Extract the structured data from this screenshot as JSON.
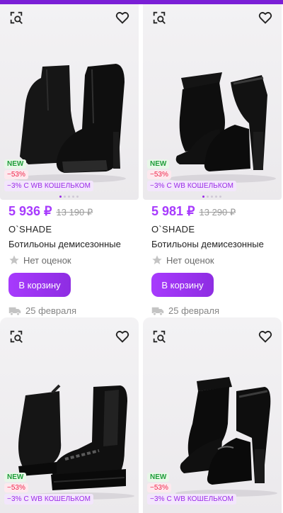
{
  "accent_color": "#a73afd",
  "products": [
    {
      "badge_new": "NEW",
      "badge_sale": "−53%",
      "badge_wallet": "−3% С WB КОШЕЛЬКОМ",
      "price": "5 936 ₽",
      "old_price": "13 190 ₽",
      "brand": "O`SHADE",
      "name": "Ботильоны демисезонные",
      "rating_text": "Нет оценок",
      "cart_label": "В корзину",
      "delivery": "25 февраля"
    },
    {
      "badge_new": "NEW",
      "badge_sale": "−53%",
      "badge_wallet": "−3% С WB КОШЕЛЬКОМ",
      "price": "5 981 ₽",
      "old_price": "13 290 ₽",
      "brand": "O`SHADE",
      "name": "Ботильоны демисезонные",
      "rating_text": "Нет оценок",
      "cart_label": "В корзину",
      "delivery": "25 февраля"
    },
    {
      "badge_new": "NEW",
      "badge_sale": "−53%",
      "badge_wallet": "−3% С WB КОШЕЛЬКОМ"
    },
    {
      "badge_new": "NEW",
      "badge_sale": "−53%",
      "badge_wallet": "−3% С WB КОШЕЛЬКОМ"
    }
  ]
}
